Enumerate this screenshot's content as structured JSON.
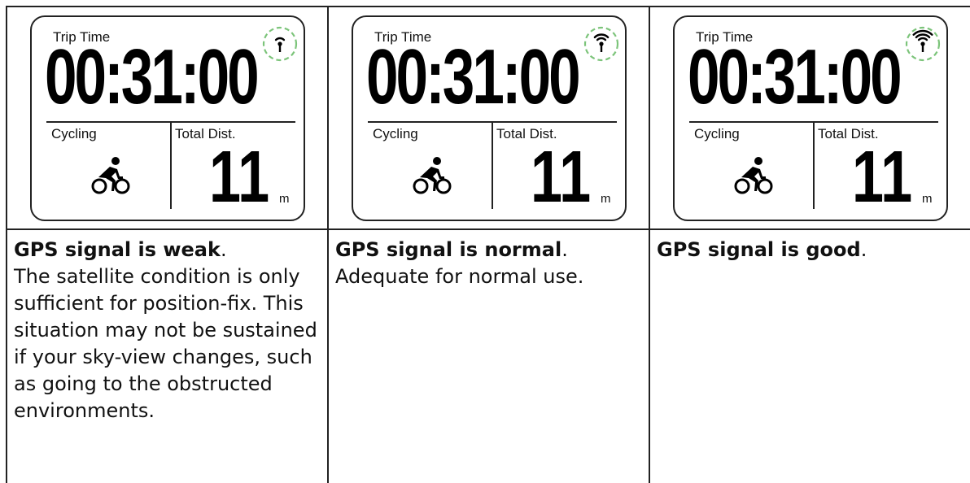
{
  "colors": {
    "gps_circle": "#7cc47a",
    "ink": "#111111"
  },
  "panels": [
    {
      "screen": {
        "trip_label": "Trip Time",
        "trip_time": "00:31:00",
        "activity_label": "Cycling",
        "distance_label": "Total Dist.",
        "distance_value": "11",
        "distance_unit": "m",
        "activity_icon": "cyclist-icon",
        "gps_icon": "gps-signal-weak-icon",
        "gps_level": 1
      },
      "title": "GPS signal is weak",
      "title_end": ".",
      "body": "The satellite condition is only sufficient for position-fix. This situation may not be sustained if your sky-view changes, such as going to the obstructed environments."
    },
    {
      "screen": {
        "trip_label": "Trip Time",
        "trip_time": "00:31:00",
        "activity_label": "Cycling",
        "distance_label": "Total Dist.",
        "distance_value": "11",
        "distance_unit": "m",
        "activity_icon": "cyclist-icon",
        "gps_icon": "gps-signal-normal-icon",
        "gps_level": 2
      },
      "title": "GPS signal is normal",
      "title_end": ".",
      "body": "Adequate for normal use."
    },
    {
      "screen": {
        "trip_label": "Trip Time",
        "trip_time": "00:31:00",
        "activity_label": "Cycling",
        "distance_label": "Total Dist.",
        "distance_value": "11",
        "distance_unit": "m",
        "activity_icon": "cyclist-icon",
        "gps_icon": "gps-signal-good-icon",
        "gps_level": 3
      },
      "title": "GPS signal is good",
      "title_end": ".",
      "body": ""
    }
  ]
}
